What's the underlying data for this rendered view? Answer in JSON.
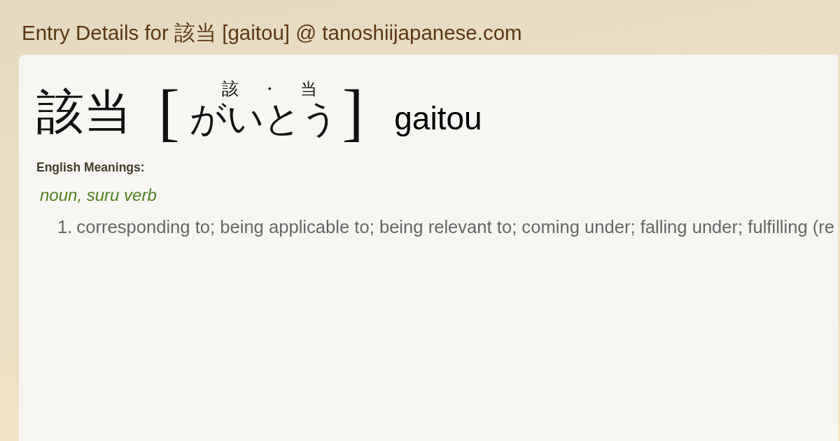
{
  "page_title": "Entry Details for 該当 [gaitou] @ tanoshiijapanese.com",
  "entry": {
    "headword": "該当",
    "brackets": [
      "[",
      "]"
    ],
    "furigana": [
      "該",
      "・",
      "当"
    ],
    "kana": "がいとう",
    "romaji": "gaitou"
  },
  "meanings_heading": "English Meanings:",
  "part_of_speech": "noun, suru verb",
  "meanings": [
    {
      "number": "1.",
      "text": "corresponding to; being applicable to; being relevant to; coming under; falling under; fulfilling (re"
    }
  ]
}
